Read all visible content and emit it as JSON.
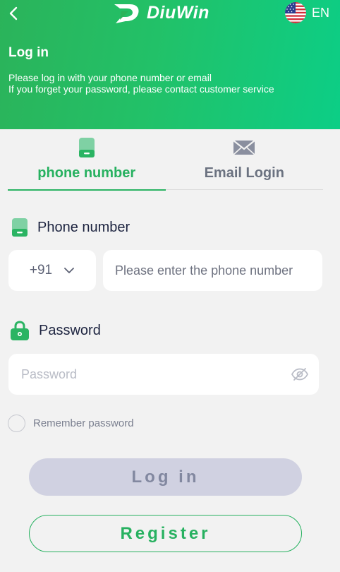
{
  "header": {
    "brand": "DiuWin",
    "language": "EN",
    "title": "Log in",
    "subtitle_line1": "Please log in with your phone number or email",
    "subtitle_line2": "If you forget your password, please contact customer service"
  },
  "tabs": [
    {
      "label": "phone number",
      "active": true,
      "icon": "phone-icon"
    },
    {
      "label": "Email Login",
      "active": false,
      "icon": "envelope-icon"
    }
  ],
  "phone": {
    "label": "Phone number",
    "country_code": "+91",
    "placeholder": "Please enter the phone number"
  },
  "password": {
    "label": "Password",
    "placeholder": "Password"
  },
  "remember_label": "Remember password",
  "buttons": {
    "login": "Log in",
    "register": "Register"
  },
  "colors": {
    "accent": "#27b160",
    "header_start": "#2bb35a",
    "header_end": "#0cce86",
    "login_button_bg": "#d0d1e1"
  }
}
